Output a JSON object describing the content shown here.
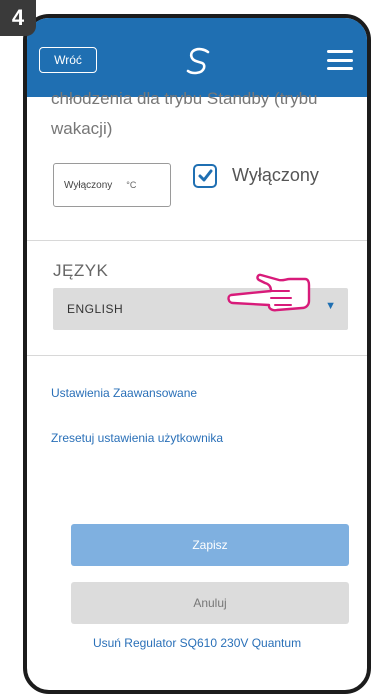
{
  "step": "4",
  "header": {
    "back_label": "Wróć",
    "logo_icon": "salus-s-logo-icon",
    "menu_icon": "hamburger-menu-icon",
    "color": "#1f6fb2"
  },
  "standby": {
    "description_line1": "chłodzenia dla trybu Standby (trybu",
    "description_line2": "wakacji)",
    "temp_value": "Wyłączony",
    "temp_unit": "°C",
    "checkbox_checked": true,
    "checkbox_label": "Wyłączony"
  },
  "language": {
    "label": "JĘZYK",
    "selected": "ENGLISH"
  },
  "links": {
    "advanced": "Ustawienia Zaawansowane",
    "reset": "Zresetuj ustawienia użytkownika",
    "remove": "Usuń Regulator SQ610 230V Quantum"
  },
  "buttons": {
    "save": "Zapisz",
    "cancel": "Anuluj"
  },
  "pointer": {
    "icon": "pointing-hand-icon",
    "color": "#d81b7a"
  }
}
